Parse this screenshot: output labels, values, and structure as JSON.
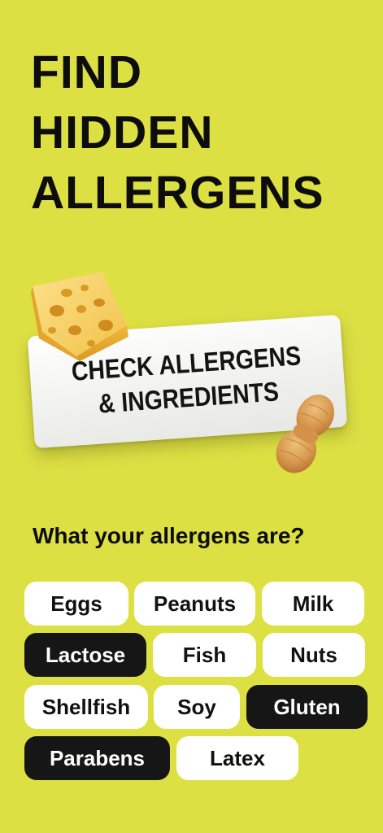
{
  "headline": {
    "line1": "FIND",
    "line2": "HIDDEN",
    "line3": "ALLERGENS"
  },
  "sticker": {
    "line1": "CHECK ALLERGENS",
    "line2": "& INGREDIENTS"
  },
  "question": "What your allergens are?",
  "colors": {
    "background": "#dde043",
    "chip": "#ffffff",
    "chip_selected": "#161616",
    "text": "#111111"
  },
  "allergens": [
    {
      "label": "Eggs",
      "selected": false
    },
    {
      "label": "Peanuts",
      "selected": false
    },
    {
      "label": "Milk",
      "selected": false
    },
    {
      "label": "Lactose",
      "selected": true
    },
    {
      "label": "Fish",
      "selected": false
    },
    {
      "label": "Nuts",
      "selected": false
    },
    {
      "label": "Shellfish",
      "selected": false
    },
    {
      "label": "Soy",
      "selected": false
    },
    {
      "label": "Gluten",
      "selected": true
    },
    {
      "label": "Parabens",
      "selected": true
    },
    {
      "label": "Latex",
      "selected": false
    }
  ]
}
